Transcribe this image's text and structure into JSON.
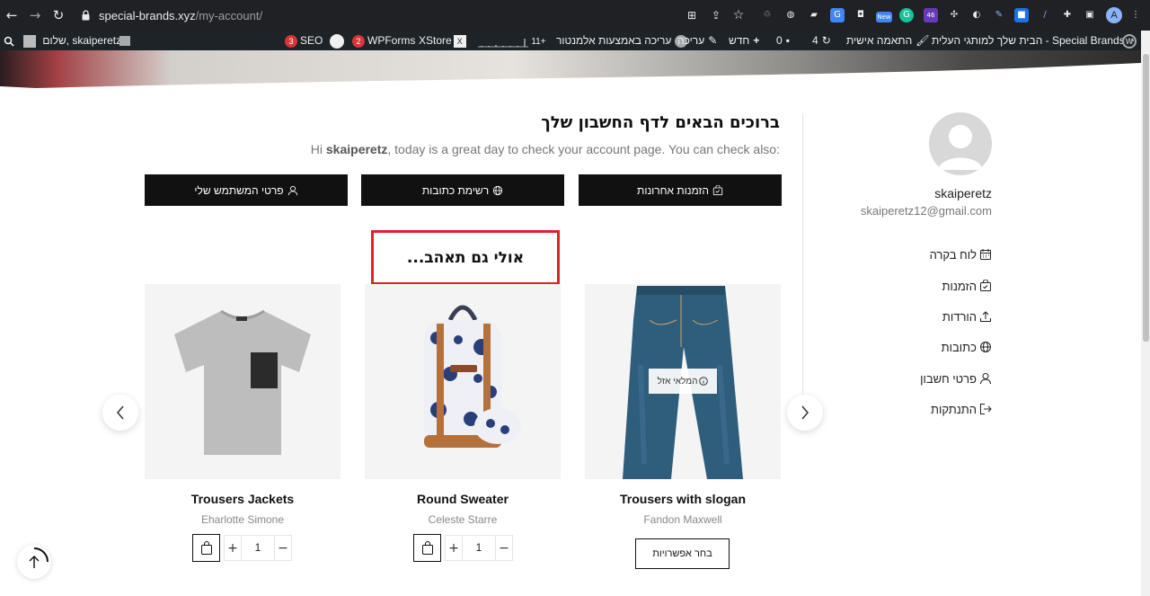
{
  "browser": {
    "url_host": "special-brands.xyz",
    "url_path": "/my-account/",
    "profile_initial": "A",
    "ext_badges": [
      "New",
      "46"
    ]
  },
  "wp_admin_bar": {
    "site_name": "Special Brands - הבית שלך למותגי העלית",
    "customize": "התאמה אישית",
    "updates_count": "4",
    "comments_count": "0",
    "new_label": "חדש",
    "edit_label": "עריכה",
    "elementor_label": "עריכה באמצעות אלמנטור",
    "stats_value": "11",
    "xstore_label": "XStore",
    "wpforms_label": "WPForms",
    "wpforms_count": "2",
    "seo_label": "SEO",
    "seo_count": "3",
    "greeting": "שלום, skaiperetz"
  },
  "sidebar": {
    "username": "skaiperetz",
    "email": "skaiperetz12@gmail.com",
    "items": [
      {
        "label": "לוח בקרה",
        "icon": "calendar-icon"
      },
      {
        "label": "הזמנות",
        "icon": "bag-icon"
      },
      {
        "label": "הורדות",
        "icon": "upload-icon"
      },
      {
        "label": "כתובות",
        "icon": "globe-icon"
      },
      {
        "label": "פרטי חשבון",
        "icon": "user-icon"
      },
      {
        "label": "התנתקות",
        "icon": "logout-icon"
      }
    ]
  },
  "main": {
    "title": "ברוכים הבאים לדף החשבון שלך",
    "intro_prefix": "Hi ",
    "intro_user": "skaiperetz",
    "intro_suffix": ", today is a great day to check your account page. You can check also:",
    "buttons": [
      {
        "label": "הזמנות אחרונות",
        "icon": "bag-icon"
      },
      {
        "label": "רשימת כתובות",
        "icon": "globe-icon"
      },
      {
        "label": "פרטי המשתמש שלי",
        "icon": "user-icon"
      }
    ],
    "suggest_title": "אולי גם תאהב..."
  },
  "products": [
    {
      "name": "Trousers with slogan",
      "vendor": "Fandon Maxwell",
      "action": "בחר אפשרויות",
      "badge": "המלאי אזל"
    },
    {
      "name": "Round Sweater",
      "vendor": "Celeste Starre",
      "qty": "1"
    },
    {
      "name": "Trousers Jackets",
      "vendor": "Eharlotte Simone",
      "qty": "1"
    }
  ],
  "colors": {
    "highlight_border": "#e2202a",
    "button_bg": "#111111",
    "wp_bar_bg": "#1d2327",
    "chrome_bg": "#202124"
  }
}
